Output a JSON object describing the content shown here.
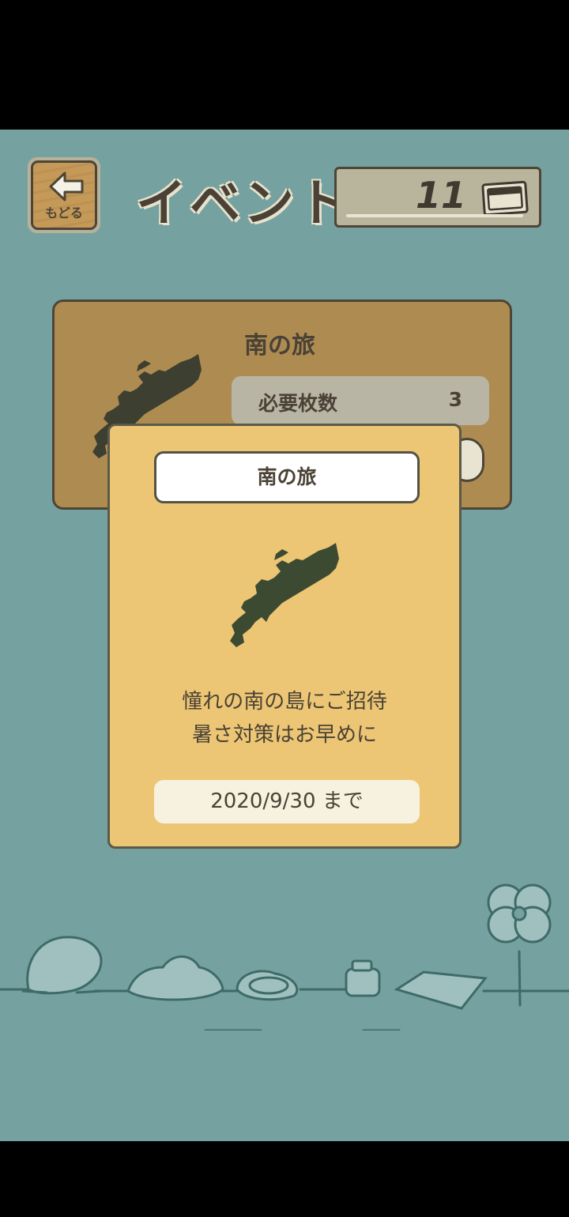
{
  "header": {
    "back_label": "もどる",
    "title": "イベント",
    "ticket_count": "11"
  },
  "event_card": {
    "title": "南の旅",
    "required_label": "必要枚数",
    "required_value": "3"
  },
  "popup": {
    "title": "南の旅",
    "description_line1": "憧れの南の島にご招待",
    "description_line2": "暑さ対策はお早めに",
    "deadline": "2020/9/30 まで"
  },
  "icons": {
    "back": "arrow-left-icon",
    "ticket": "ticket-icon",
    "island": "island-silhouette-icon"
  },
  "colors": {
    "background": "#75a2a0",
    "popup": "#ecc674",
    "card": "#ae8b51"
  }
}
